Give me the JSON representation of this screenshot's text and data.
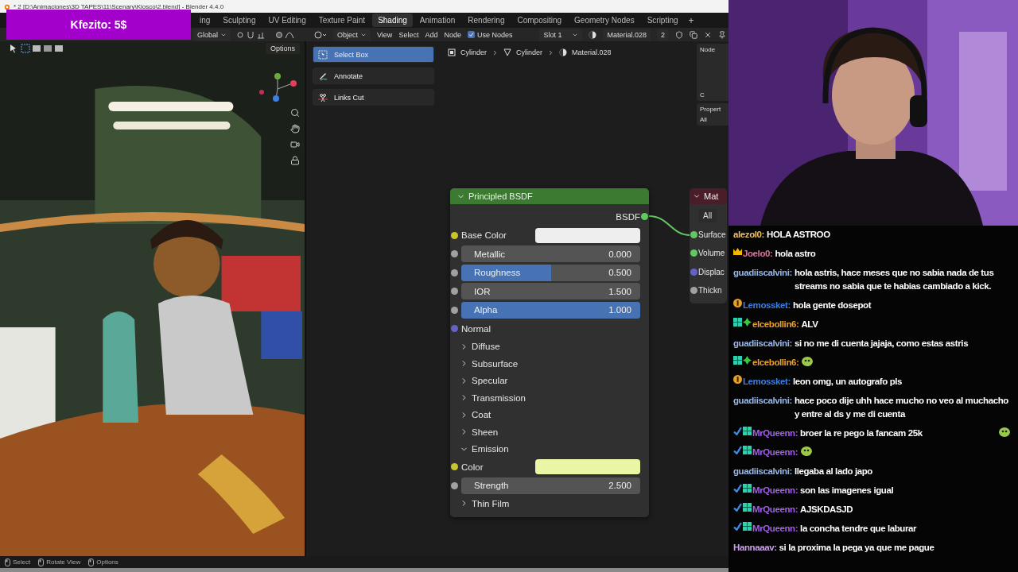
{
  "window": {
    "title": "* 2 [D:\\Animaciones\\3D TAPES\\11\\Scenary\\Kiosco\\2.blend] - Blender 4.4.0"
  },
  "donation_alert": {
    "text": "Kfezito: 5$"
  },
  "workspace_tabs": [
    {
      "label": "ing",
      "selected": false
    },
    {
      "label": "Sculpting",
      "selected": false
    },
    {
      "label": "UV Editing",
      "selected": false
    },
    {
      "label": "Texture Paint",
      "selected": false
    },
    {
      "label": "Shading",
      "selected": true
    },
    {
      "label": "Animation",
      "selected": false
    },
    {
      "label": "Rendering",
      "selected": false
    },
    {
      "label": "Compositing",
      "selected": false
    },
    {
      "label": "Geometry Nodes",
      "selected": false
    },
    {
      "label": "Scripting",
      "selected": false
    }
  ],
  "add_workspace": "+",
  "viewport": {
    "orientation": "Global",
    "options": "Options"
  },
  "node_header": {
    "mode": "Object",
    "menus": [
      "View",
      "Select",
      "Add",
      "Node"
    ],
    "use_nodes": {
      "label": "Use Nodes",
      "checked": true
    },
    "slot": "Slot 1",
    "material": "Material.028",
    "users": "2"
  },
  "tools": [
    {
      "label": "Select Box",
      "selected": true
    },
    {
      "label": "Annotate",
      "selected": false
    },
    {
      "label": "Links Cut",
      "selected": false
    }
  ],
  "breadcrumbs": [
    "Cylinder",
    "Cylinder",
    "Material.028"
  ],
  "sidebar": {
    "node_panel": "Node",
    "cut_label": "C",
    "properties_panel": "Propert",
    "filter": "All"
  },
  "principled_node": {
    "title": "Principled BSDF",
    "output": "BSDF",
    "inputs": [
      {
        "kind": "color",
        "label": "Base Color",
        "color": "#c7c729",
        "swatch": {
          "color": "#eeeeee"
        }
      },
      {
        "kind": "slider",
        "label": "Metallic",
        "value": "0.000",
        "level": 0,
        "color": "#a1a1a1"
      },
      {
        "kind": "slider",
        "label": "Roughness",
        "value": "0.500",
        "level": 0.5,
        "color": "#a1a1a1"
      },
      {
        "kind": "number",
        "label": "IOR",
        "value": "1.500",
        "color": "#a1a1a1"
      },
      {
        "kind": "slider",
        "label": "Alpha",
        "value": "1.000",
        "level": 1,
        "color": "#a1a1a1"
      },
      {
        "kind": "socket",
        "label": "Normal",
        "color": "#6363c7"
      },
      {
        "kind": "panel",
        "label": "Diffuse",
        "expanded": false
      },
      {
        "kind": "panel",
        "label": "Subsurface",
        "expanded": false
      },
      {
        "kind": "panel",
        "label": "Specular",
        "expanded": false
      },
      {
        "kind": "panel",
        "label": "Transmission",
        "expanded": false
      },
      {
        "kind": "panel",
        "label": "Coat",
        "expanded": false
      },
      {
        "kind": "panel",
        "label": "Sheen",
        "expanded": false
      },
      {
        "kind": "panel",
        "label": "Emission",
        "expanded": true,
        "children": [
          {
            "kind": "color",
            "label": "Color",
            "color": "#c7c729",
            "swatch": {
              "color": "#eaf5a6"
            }
          },
          {
            "kind": "number",
            "label": "Strength",
            "value": "2.500",
            "color": "#a1a1a1"
          }
        ]
      },
      {
        "kind": "panel",
        "label": "Thin Film",
        "expanded": false
      }
    ]
  },
  "output_node": {
    "title": "Mat",
    "target": "All",
    "inputs": [
      {
        "label": "Surface",
        "color": "#63c763"
      },
      {
        "label": "Volume",
        "color": "#63c763"
      },
      {
        "label": "Displac",
        "color": "#6363c7"
      },
      {
        "label": "Thickn",
        "color": "#a1a1a1"
      }
    ]
  },
  "status_bar": [
    "Select",
    "Rotate View",
    "Options"
  ],
  "chat": [
    {
      "user": "alezol0:",
      "color": "#f0c060",
      "text": "HOLA ASTROO",
      "emote": false
    },
    {
      "user": "Joelo0:",
      "color": "#e070a0",
      "badges": [
        {
          "kind": "crown"
        }
      ],
      "text": "hola astro",
      "emote": false
    },
    {
      "user": "guadiiscalvini:",
      "color": "#9bb8e8",
      "text": "hola astris, hace meses que no sabia nada de tus streams no sabia que te habias cambiado a kick.",
      "emote": false
    },
    {
      "user": "Lemossket:",
      "color": "#3d7fe0",
      "badges": [
        {
          "kind": "coin"
        }
      ],
      "text": "hola gente dosepot",
      "emote": false
    },
    {
      "user": "elcebollin6:",
      "color": "#e8a030",
      "badges": [
        {
          "kind": "sub"
        },
        {
          "kind": "gem"
        }
      ],
      "text": "ALV",
      "emote": false
    },
    {
      "user": "guadiiscalvini:",
      "color": "#9bb8e8",
      "text": "si no me di cuenta jajaja, como estas astris",
      "emote": false
    },
    {
      "user": "elcebollin6:",
      "color": "#e8a030",
      "badges": [
        {
          "kind": "sub"
        },
        {
          "kind": "gem"
        }
      ],
      "emote": true
    },
    {
      "user": "Lemossket:",
      "color": "#3d7fe0",
      "badges": [
        {
          "kind": "coin"
        }
      ],
      "text": "leon omg, un autografo pls",
      "emote": false
    },
    {
      "user": "guadiiscalvini:",
      "color": "#9bb8e8",
      "text": "hace poco dije uhh hace mucho no veo al muchacho y entre al ds y me di cuenta",
      "emote": false
    },
    {
      "user": "MrQueenn:",
      "color": "#a060e8",
      "badges": [
        {
          "kind": "check"
        },
        {
          "kind": "sub"
        }
      ],
      "text": "broer la re pego la fancam 25k",
      "emote": true
    },
    {
      "user": "MrQueenn:",
      "color": "#a060e8",
      "badges": [
        {
          "kind": "check"
        },
        {
          "kind": "sub"
        }
      ],
      "emote": true
    },
    {
      "user": "guadiiscalvini:",
      "color": "#9bb8e8",
      "text": "llegaba al lado japo",
      "emote": false
    },
    {
      "user": "MrQueenn:",
      "color": "#a060e8",
      "badges": [
        {
          "kind": "check"
        },
        {
          "kind": "sub"
        }
      ],
      "text": "son las imagenes igual",
      "emote": false
    },
    {
      "user": "MrQueenn:",
      "color": "#a060e8",
      "badges": [
        {
          "kind": "check"
        },
        {
          "kind": "sub"
        }
      ],
      "text": "AJSKDASJD",
      "emote": false
    },
    {
      "user": "MrQueenn:",
      "color": "#a060e8",
      "badges": [
        {
          "kind": "check"
        },
        {
          "kind": "sub"
        }
      ],
      "text": "la concha tendre que laburar",
      "emote": false
    },
    {
      "user": "Hannaaav:",
      "color": "#c8a0e8",
      "text": "si la proxima la pega ya que me pague",
      "emote": false
    }
  ]
}
